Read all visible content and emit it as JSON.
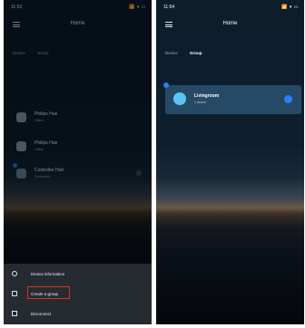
{
  "left_screen": {
    "status": {
      "time": "11:53",
      "icons": "📶 ▾ ▭"
    },
    "title": "Home",
    "tabs": [
      "Device",
      "Group"
    ],
    "devices": [
      {
        "name": "Philips Hue",
        "status": "Offline"
      },
      {
        "name": "Philips Hue",
        "status": "Offline"
      },
      {
        "name": "Controller Hub",
        "status": "Connected"
      }
    ],
    "menu": [
      "Device information",
      "Create a group",
      "Disconnect"
    ]
  },
  "right_screen": {
    "status": {
      "time": "11:54",
      "icons": "📶 ▾ ▭"
    },
    "title": "Home",
    "tabs": [
      "Device",
      "Group"
    ],
    "group": {
      "name": "Livingroom",
      "count": "1 device"
    }
  },
  "colors": {
    "accent": "#2d7df6",
    "highlight": "#e02b2b",
    "group_card": "#264a66"
  }
}
